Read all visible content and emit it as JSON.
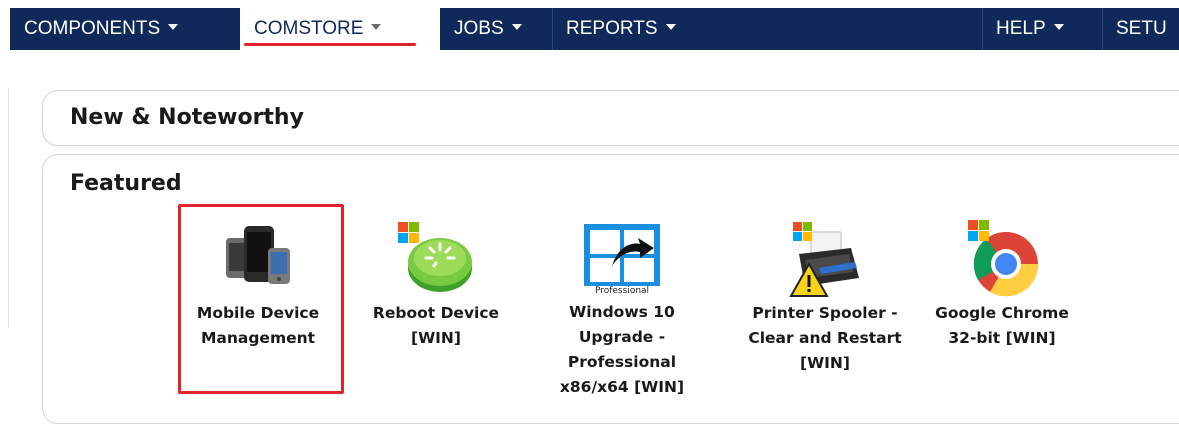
{
  "nav": {
    "items": [
      {
        "label": "COMPONENTS",
        "active": false
      },
      {
        "label": "COMSTORE",
        "active": true
      },
      {
        "label": "JOBS",
        "active": false
      },
      {
        "label": "REPORTS",
        "active": false
      }
    ],
    "right_items": [
      {
        "label": "HELP"
      },
      {
        "label": "SETU"
      }
    ],
    "accent": "#e0202a",
    "bar_color": "#0f2a5a"
  },
  "sections": {
    "new_noteworthy": {
      "title": "New & Noteworthy"
    },
    "featured": {
      "title": "Featured",
      "items": [
        {
          "label": "Mobile Device Management",
          "icon": "mobile-devices-icon",
          "selected": true
        },
        {
          "label": "Reboot Device [WIN]",
          "icon": "reboot-icon",
          "selected": false
        },
        {
          "label": "Windows 10 Upgrade - Professional x86/x64 [WIN]",
          "icon": "windows10-icon",
          "icon_caption": "Professional",
          "selected": false
        },
        {
          "label": "Printer Spooler - Clear and Restart [WIN]",
          "icon": "printer-warning-icon",
          "selected": false
        },
        {
          "label": "Google Chrome 32-bit [WIN]",
          "icon": "chrome-icon",
          "selected": false
        }
      ]
    }
  }
}
